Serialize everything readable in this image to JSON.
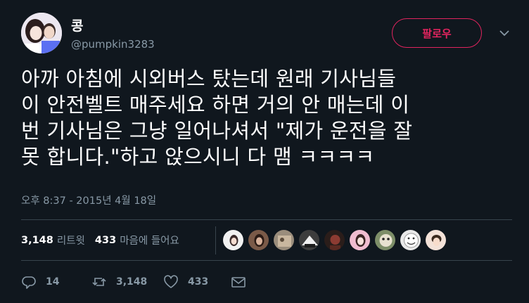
{
  "author": {
    "name": "콩",
    "handle": "@pumpkin3283"
  },
  "follow_label": "팔로우",
  "tweet": {
    "lines": [
      "아까 아침에 시외버스 탔는데 원래 기사님들",
      "이 안전벨트 매주세요 하면 거의 안 매는데 이",
      "번 기사님은 그냥 일어나셔서 \"제가 운전을 잘",
      "못 합니다.\"하고 앉으시니 다 맴 ㅋㅋㅋㅋ"
    ]
  },
  "timestamp": "오후 8:37 - 2015년 4월 18일",
  "stats": {
    "retweet_count": "3,148",
    "retweet_label": "리트윗",
    "like_count": "433",
    "like_label": "마음에 들어요"
  },
  "actions": {
    "reply_count": "14",
    "retweet_count": "3,148",
    "like_count": "433"
  },
  "colors": {
    "background": "#10171e",
    "accent": "#e0245e",
    "muted": "#8899a6",
    "divider": "#38444d"
  },
  "likers": [
    {
      "name": "liker-1",
      "color": "#f1f1f1"
    },
    {
      "name": "liker-2",
      "color": "#7a5a48"
    },
    {
      "name": "liker-3",
      "color": "#9a8d7c"
    },
    {
      "name": "liker-4",
      "color": "#3d3d3d"
    },
    {
      "name": "liker-5",
      "color": "#2a1d1a"
    },
    {
      "name": "liker-6",
      "color": "#f0bcd0"
    },
    {
      "name": "liker-7",
      "color": "#7d8e68"
    },
    {
      "name": "liker-8",
      "color": "#e9e9e9"
    },
    {
      "name": "liker-9",
      "color": "#f3e2d8"
    }
  ]
}
